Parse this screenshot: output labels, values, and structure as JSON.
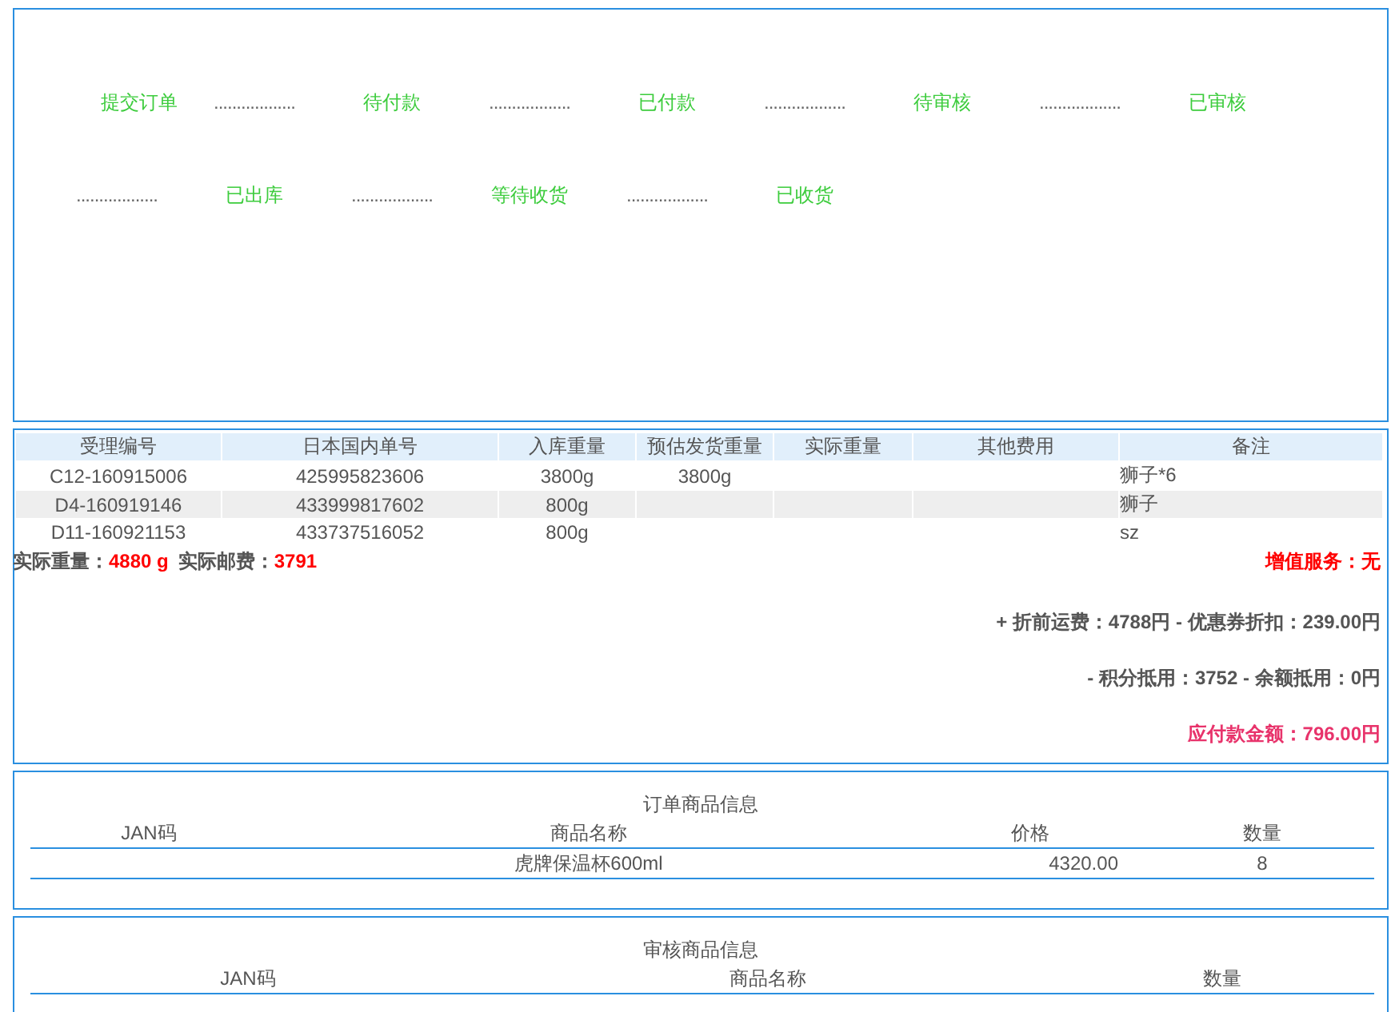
{
  "progress": [
    {
      "kind": "step",
      "label": "提交订单"
    },
    {
      "kind": "dots",
      "label": ".................."
    },
    {
      "kind": "step",
      "label": "待付款"
    },
    {
      "kind": "dots",
      "label": ".................."
    },
    {
      "kind": "step",
      "label": "已付款"
    },
    {
      "kind": "dots",
      "label": ".................."
    },
    {
      "kind": "step",
      "label": "待审核"
    },
    {
      "kind": "dots",
      "label": ".................."
    },
    {
      "kind": "step",
      "label": "已审核"
    },
    {
      "kind": "dots",
      "label": ".................."
    },
    {
      "kind": "step",
      "label": "已出库"
    },
    {
      "kind": "dots",
      "label": ".................."
    },
    {
      "kind": "step",
      "label": "等待收货"
    },
    {
      "kind": "dots",
      "label": ".................."
    },
    {
      "kind": "step",
      "label": "已收货"
    }
  ],
  "parcels": {
    "columns": [
      "受理编号",
      "日本国内单号",
      "入库重量",
      "预估发货重量",
      "实际重量",
      "其他费用",
      "备注"
    ],
    "rows": [
      [
        "C12-160915006",
        "425995823606",
        "3800g",
        "3800g",
        "",
        "",
        "狮子*6"
      ],
      [
        "D4-160919146",
        "433999817602",
        "800g",
        "",
        "",
        "",
        "狮子"
      ],
      [
        "D11-160921153",
        "433737516052",
        "800g",
        "",
        "",
        "",
        "sz"
      ]
    ]
  },
  "summary": {
    "weight_label": "实际重量：",
    "weight": "4880 g",
    "postage_label": "实际邮费：",
    "postage": "3791",
    "service": "增值服务：无",
    "lines": [
      {
        "kind": "normal",
        "text": "+ 折前运费：4788円 - 优惠券折扣：239.00円"
      },
      {
        "kind": "normal",
        "text": "- 积分抵用：3752 - 余额抵用：0円"
      },
      {
        "kind": "total",
        "text": "应付款金额：796.00円"
      }
    ]
  },
  "order_goods": {
    "title": "订单商品信息",
    "columns": [
      "JAN码",
      "商品名称",
      "价格",
      "数量"
    ],
    "rows": [
      [
        "",
        "虎牌保温杯600ml",
        "4320.00",
        "8"
      ]
    ]
  },
  "review_goods": {
    "title": "审核商品信息",
    "columns": [
      "JAN码",
      "商品名称",
      "数量"
    ]
  }
}
